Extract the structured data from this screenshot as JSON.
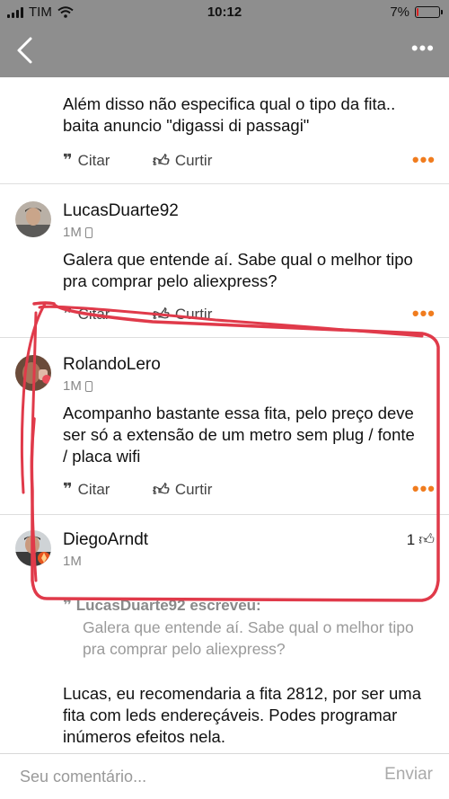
{
  "status_bar": {
    "carrier": "TIM",
    "time": "10:12",
    "battery": "7%",
    "battery_level": 0.07
  },
  "nav": {
    "back_icon": "chevron-left-icon",
    "more_icon": "ellipsis-icon"
  },
  "posts": [
    {
      "body": "Além disso não especifica qual o tipo da fita.. baita anuncio \"digassi di passagi\"",
      "quote_label": "Citar",
      "like_label": "Curtir"
    },
    {
      "author": "LucasDuarte92",
      "time": "1M",
      "body": "Galera que entende aí. Sabe qual o melhor tipo pra comprar pelo aliexpress?",
      "quote_label": "Citar",
      "like_label": "Curtir"
    },
    {
      "author": "RolandoLero",
      "time": "1M",
      "body": "Acompanho bastante essa fita, pelo preço deve ser só a extensão de um metro sem plug / fonte / placa wifi",
      "quote_label": "Citar",
      "like_label": "Curtir"
    },
    {
      "author": "DiegoArndt",
      "time": "1M",
      "likes": "1",
      "quote": {
        "header": "LucasDuarte92 escreveu:",
        "text": "Galera que entende aí. Sabe qual o melhor tipo pra comprar pelo aliexpress?"
      },
      "body": "Lucas, eu recomendaria a fita 2812, por ser uma fita com leds endereçáveis. Podes programar inúmeros efeitos nela."
    }
  ],
  "composer": {
    "placeholder": "Seu comentário...",
    "send_label": "Enviar"
  },
  "colors": {
    "accent": "#f07c1e",
    "annotation": "#e03a4a",
    "navbar": "#8e8e8e"
  }
}
